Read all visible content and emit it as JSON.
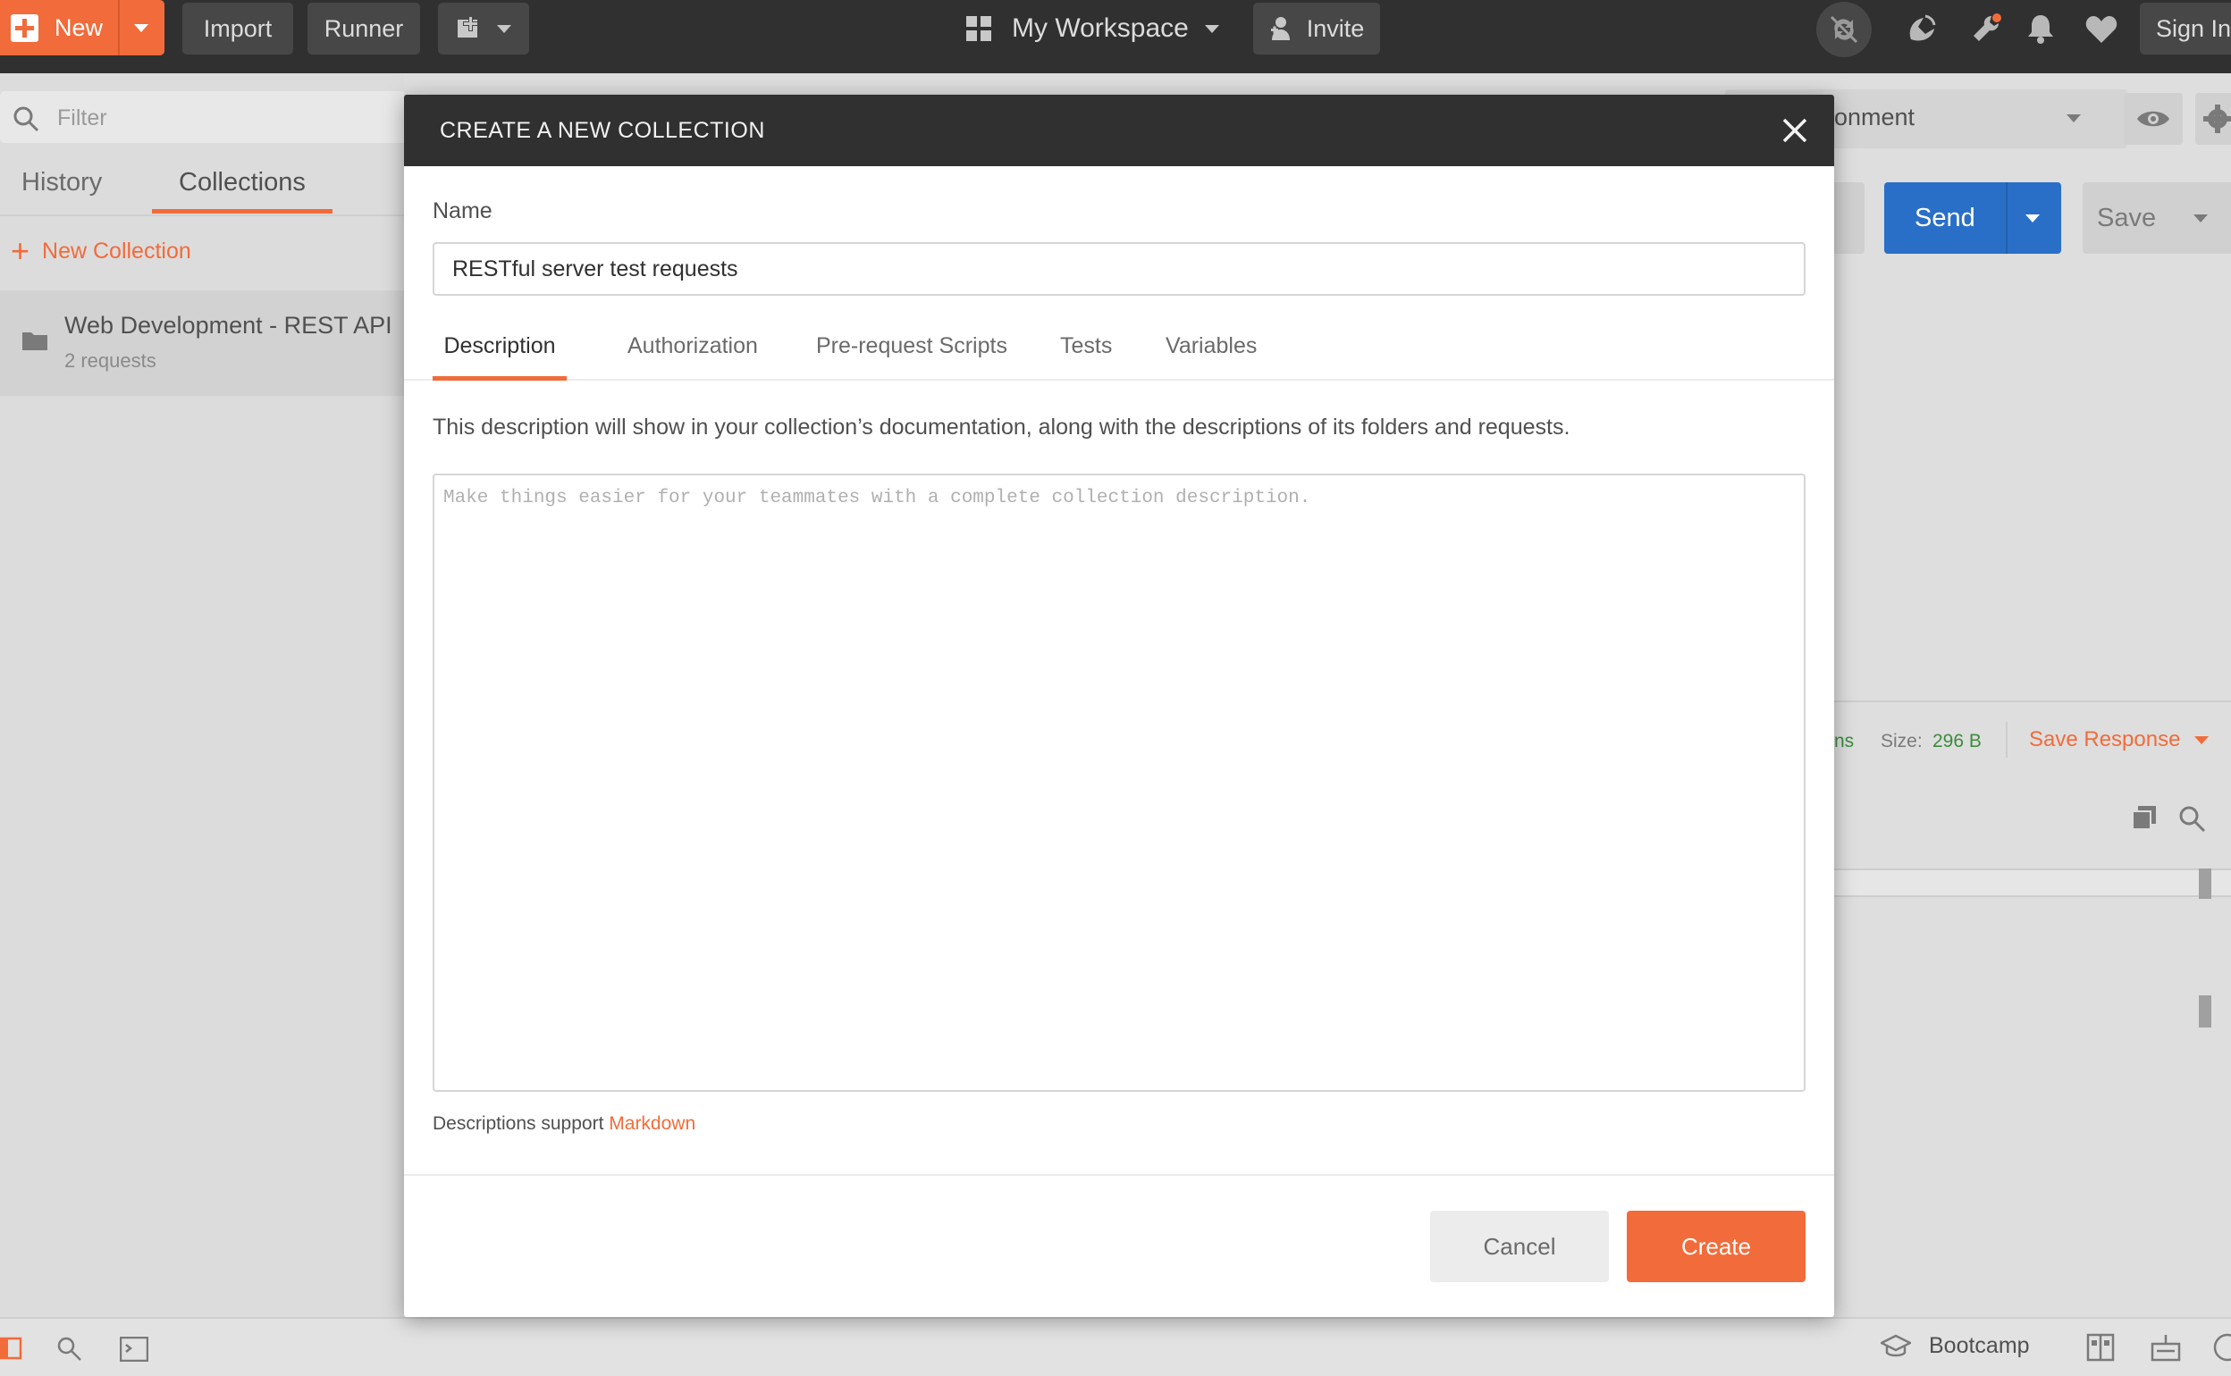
{
  "topbar": {
    "new_label": "New",
    "import_label": "Import",
    "runner_label": "Runner",
    "workspace_label": "My Workspace",
    "invite_label": "Invite",
    "signin_label": "Sign In"
  },
  "sidebar": {
    "filter_placeholder": "Filter",
    "tabs": [
      "History",
      "Collections"
    ],
    "new_collection_label": "New Collection",
    "collection": {
      "name": "Web Development - REST API",
      "count": "2 requests"
    }
  },
  "request_pane": {
    "environment_label": "onment",
    "send_label": "Send",
    "save_label": "Save",
    "time_label": "ns",
    "size_label": "Size:",
    "size_value": "296 B",
    "save_response_label": "Save Response"
  },
  "bottombar": {
    "bootcamp_label": "Bootcamp"
  },
  "modal": {
    "title": "CREATE A NEW COLLECTION",
    "name_label": "Name",
    "name_value": "RESTful server test requests",
    "tabs": [
      "Description",
      "Authorization",
      "Pre-request Scripts",
      "Tests",
      "Variables"
    ],
    "active_tab": "Description",
    "description_help": "This description will show in your collection’s documentation, along with the descriptions of its folders and requests.",
    "description_placeholder": "Make things easier for your teammates with a complete collection description.",
    "markdown_note": "Descriptions support",
    "markdown_link": "Markdown",
    "cancel_label": "Cancel",
    "create_label": "Create"
  },
  "colors": {
    "accent": "#f26b3a",
    "send_blue": "#2a6fc7",
    "topbar": "#303030",
    "size_green": "#3c8c3c"
  },
  "icons": [
    "plus-icon",
    "chevron-down-icon",
    "workspace-grid-icon",
    "add-user-icon",
    "sync-off-icon",
    "satellite-icon",
    "wrench-icon",
    "bell-icon",
    "heart-icon",
    "search-icon",
    "folder-icon",
    "eye-icon",
    "gear-icon",
    "close-icon",
    "copy-icon",
    "sidebar-toggle-icon",
    "console-icon",
    "graduation-cap-icon",
    "two-pane-icon",
    "keyboard-icon",
    "help-icon"
  ]
}
